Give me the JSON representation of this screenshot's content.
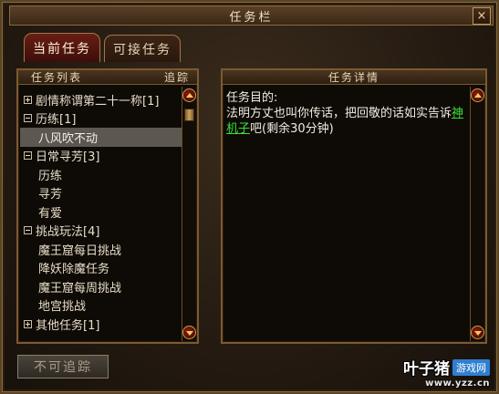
{
  "window": {
    "title": "任务栏",
    "close_label": "×"
  },
  "tabs": [
    {
      "label": "当前任务",
      "active": true
    },
    {
      "label": "可接任务",
      "active": false
    }
  ],
  "task_list": {
    "header": "任务列表",
    "track_label": "追踪",
    "items": [
      {
        "type": "category",
        "toggle": "plus",
        "label": "剧情称谓第二十一称[1]"
      },
      {
        "type": "category",
        "toggle": "minus",
        "label": "历练[1]"
      },
      {
        "type": "item",
        "label": "八风吹不动",
        "selected": true
      },
      {
        "type": "category",
        "toggle": "minus",
        "label": "日常寻芳[3]"
      },
      {
        "type": "item",
        "label": "历练"
      },
      {
        "type": "item",
        "label": "寻芳"
      },
      {
        "type": "item",
        "label": "有爱"
      },
      {
        "type": "category",
        "toggle": "minus",
        "label": "挑战玩法[4]"
      },
      {
        "type": "item",
        "label": "魔王窟每日挑战"
      },
      {
        "type": "item",
        "label": "降妖除魔任务"
      },
      {
        "type": "item",
        "label": "魔王窟每周挑战"
      },
      {
        "type": "item",
        "label": "地宫挑战"
      },
      {
        "type": "category",
        "toggle": "plus",
        "label": "其他任务[1]"
      }
    ]
  },
  "task_detail": {
    "header": "任务详情",
    "goal_label": "任务目的:",
    "text_before": "法明方丈也叫你传话，把回敬的话如实告诉",
    "npc_link": "神机子",
    "text_after": "吧(剩余30分钟)"
  },
  "footer": {
    "untrack_label": "不可追踪"
  },
  "watermark": {
    "title": "叶子猪",
    "badge": "游戏网",
    "url": "www.yzz.cn"
  },
  "colors": {
    "link": "#38e038",
    "selected_row": "#5c5750",
    "active_tab": "#6a1d16",
    "frame": "#7a5a30"
  }
}
